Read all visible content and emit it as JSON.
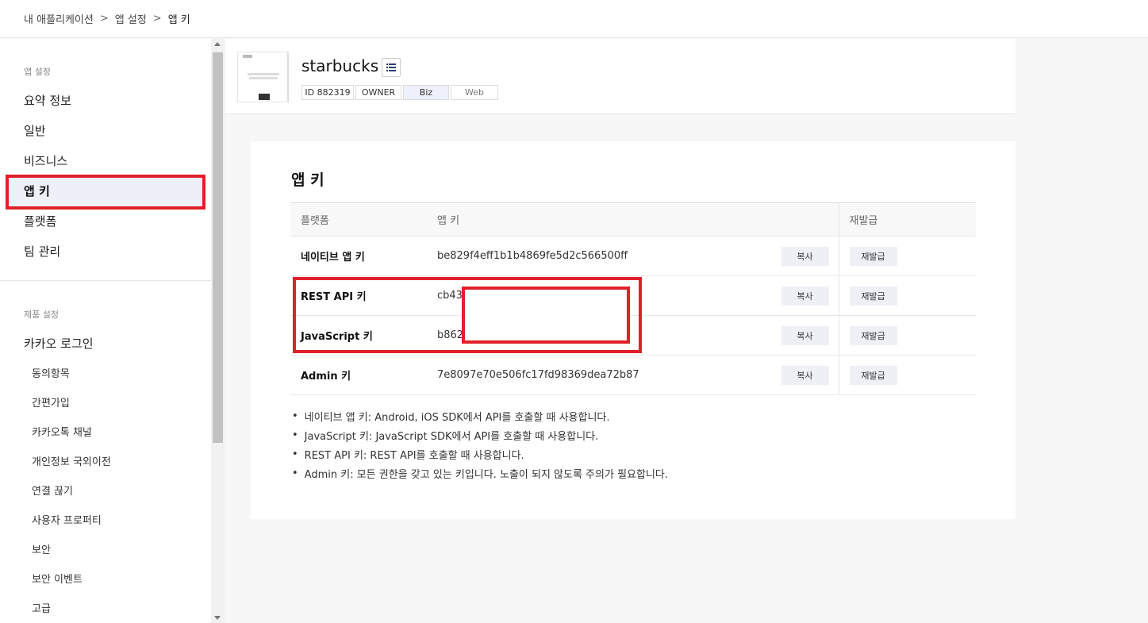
{
  "breadcrumb": {
    "items": [
      "내 애플리케이션",
      "앱 설정",
      "앱 키"
    ],
    "separator": ">"
  },
  "sidebar": {
    "section1_title": "앱 설정",
    "items": [
      "요약 정보",
      "일반",
      "비즈니스",
      "앱 키",
      "플랫폼",
      "팀 관리"
    ],
    "section2_title": "제품 설정",
    "product_item": "카카오 로그인",
    "sub_items": [
      "동의항목",
      "간편가입",
      "카카오톡 채널",
      "개인정보 국외이전",
      "연결 끊기",
      "사용자 프로퍼티",
      "보안",
      "보안 이벤트",
      "고급"
    ]
  },
  "app": {
    "name": "starbucks",
    "tags": [
      "ID 882319",
      "OWNER",
      "Biz",
      "Web"
    ]
  },
  "app_keys": {
    "title": "앱 키",
    "headers": [
      "플랫폼",
      "앱 키",
      "재발급"
    ],
    "copy_label": "복사",
    "reissue_label": "재발급",
    "rows": [
      {
        "platform": "네이티브 앱 키",
        "key": "be829f4eff1b1b4869fe5d2c566500ff"
      },
      {
        "platform": "REST API 키",
        "key": "cb43"
      },
      {
        "platform": "JavaScript 키",
        "key": "b862"
      },
      {
        "platform": "Admin 키",
        "key": "7e8097e70e506fc17fd98369dea72b87"
      }
    ],
    "notes": [
      "네이티브 앱 키: Android, iOS SDK에서 API를 호출할 때 사용합니다.",
      "JavaScript 키: JavaScript SDK에서 API를 호출할 때 사용합니다.",
      "REST API 키: REST API를 호출할 때 사용합니다.",
      "Admin 키: 모든 권한을 갖고 있는 키입니다. 노출이 되지 않도록 주의가 필요합니다."
    ]
  },
  "colors": {
    "highlight": "#e0202a",
    "active_bg": "#eef0f8"
  }
}
